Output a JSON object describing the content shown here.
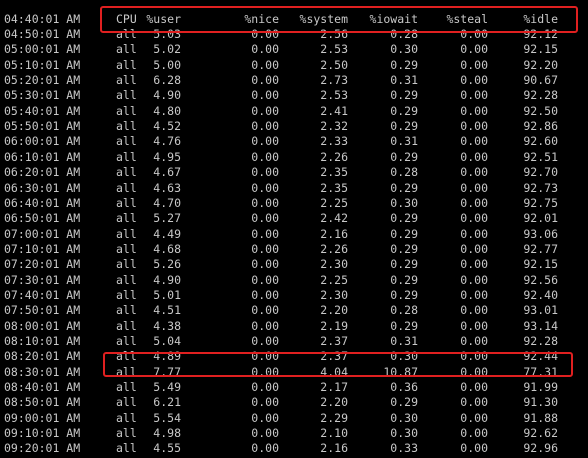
{
  "terminal": {
    "header": {
      "time": "04:40:01 AM",
      "columns": [
        "CPU",
        "%user",
        "%nice",
        "%system",
        "%iowait",
        "%steal",
        "%idle"
      ]
    },
    "rows": [
      [
        "04:50:01 AM",
        "all",
        "5.03",
        "0.00",
        "2.56",
        "0.28",
        "0.00",
        "92.12"
      ],
      [
        "05:00:01 AM",
        "all",
        "5.02",
        "0.00",
        "2.53",
        "0.30",
        "0.00",
        "92.15"
      ],
      [
        "05:10:01 AM",
        "all",
        "5.00",
        "0.00",
        "2.50",
        "0.29",
        "0.00",
        "92.20"
      ],
      [
        "05:20:01 AM",
        "all",
        "6.28",
        "0.00",
        "2.73",
        "0.31",
        "0.00",
        "90.67"
      ],
      [
        "05:30:01 AM",
        "all",
        "4.90",
        "0.00",
        "2.53",
        "0.29",
        "0.00",
        "92.28"
      ],
      [
        "05:40:01 AM",
        "all",
        "4.80",
        "0.00",
        "2.41",
        "0.29",
        "0.00",
        "92.50"
      ],
      [
        "05:50:01 AM",
        "all",
        "4.52",
        "0.00",
        "2.32",
        "0.29",
        "0.00",
        "92.86"
      ],
      [
        "06:00:01 AM",
        "all",
        "4.76",
        "0.00",
        "2.33",
        "0.31",
        "0.00",
        "92.60"
      ],
      [
        "06:10:01 AM",
        "all",
        "4.95",
        "0.00",
        "2.26",
        "0.29",
        "0.00",
        "92.51"
      ],
      [
        "06:20:01 AM",
        "all",
        "4.67",
        "0.00",
        "2.35",
        "0.28",
        "0.00",
        "92.70"
      ],
      [
        "06:30:01 AM",
        "all",
        "4.63",
        "0.00",
        "2.35",
        "0.29",
        "0.00",
        "92.73"
      ],
      [
        "06:40:01 AM",
        "all",
        "4.70",
        "0.00",
        "2.25",
        "0.30",
        "0.00",
        "92.75"
      ],
      [
        "06:50:01 AM",
        "all",
        "5.27",
        "0.00",
        "2.42",
        "0.29",
        "0.00",
        "92.01"
      ],
      [
        "07:00:01 AM",
        "all",
        "4.49",
        "0.00",
        "2.16",
        "0.29",
        "0.00",
        "93.06"
      ],
      [
        "07:10:01 AM",
        "all",
        "4.68",
        "0.00",
        "2.26",
        "0.29",
        "0.00",
        "92.77"
      ],
      [
        "07:20:01 AM",
        "all",
        "5.26",
        "0.00",
        "2.30",
        "0.29",
        "0.00",
        "92.15"
      ],
      [
        "07:30:01 AM",
        "all",
        "4.90",
        "0.00",
        "2.25",
        "0.29",
        "0.00",
        "92.56"
      ],
      [
        "07:40:01 AM",
        "all",
        "5.01",
        "0.00",
        "2.30",
        "0.29",
        "0.00",
        "92.40"
      ],
      [
        "07:50:01 AM",
        "all",
        "4.51",
        "0.00",
        "2.20",
        "0.28",
        "0.00",
        "93.01"
      ],
      [
        "08:00:01 AM",
        "all",
        "4.38",
        "0.00",
        "2.19",
        "0.29",
        "0.00",
        "93.14"
      ],
      [
        "08:10:01 AM",
        "all",
        "5.04",
        "0.00",
        "2.37",
        "0.31",
        "0.00",
        "92.28"
      ],
      [
        "08:20:01 AM",
        "all",
        "4.89",
        "0.00",
        "2.37",
        "0.30",
        "0.00",
        "92.44"
      ],
      [
        "08:30:01 AM",
        "all",
        "7.77",
        "0.00",
        "4.04",
        "10.87",
        "0.00",
        "77.31"
      ],
      [
        "08:40:01 AM",
        "all",
        "5.49",
        "0.00",
        "2.17",
        "0.36",
        "0.00",
        "91.99"
      ],
      [
        "08:50:01 AM",
        "all",
        "6.21",
        "0.00",
        "2.20",
        "0.29",
        "0.00",
        "91.30"
      ],
      [
        "09:00:01 AM",
        "all",
        "5.54",
        "0.00",
        "2.29",
        "0.30",
        "0.00",
        "91.88"
      ],
      [
        "09:10:01 AM",
        "all",
        "4.98",
        "0.00",
        "2.10",
        "0.30",
        "0.00",
        "92.62"
      ],
      [
        "09:20:01 AM",
        "all",
        "4.55",
        "0.00",
        "2.16",
        "0.33",
        "0.00",
        "92.96"
      ]
    ],
    "highlight_color": "#e02020",
    "text_color": "#c8c8c8",
    "background_color": "#000000"
  }
}
